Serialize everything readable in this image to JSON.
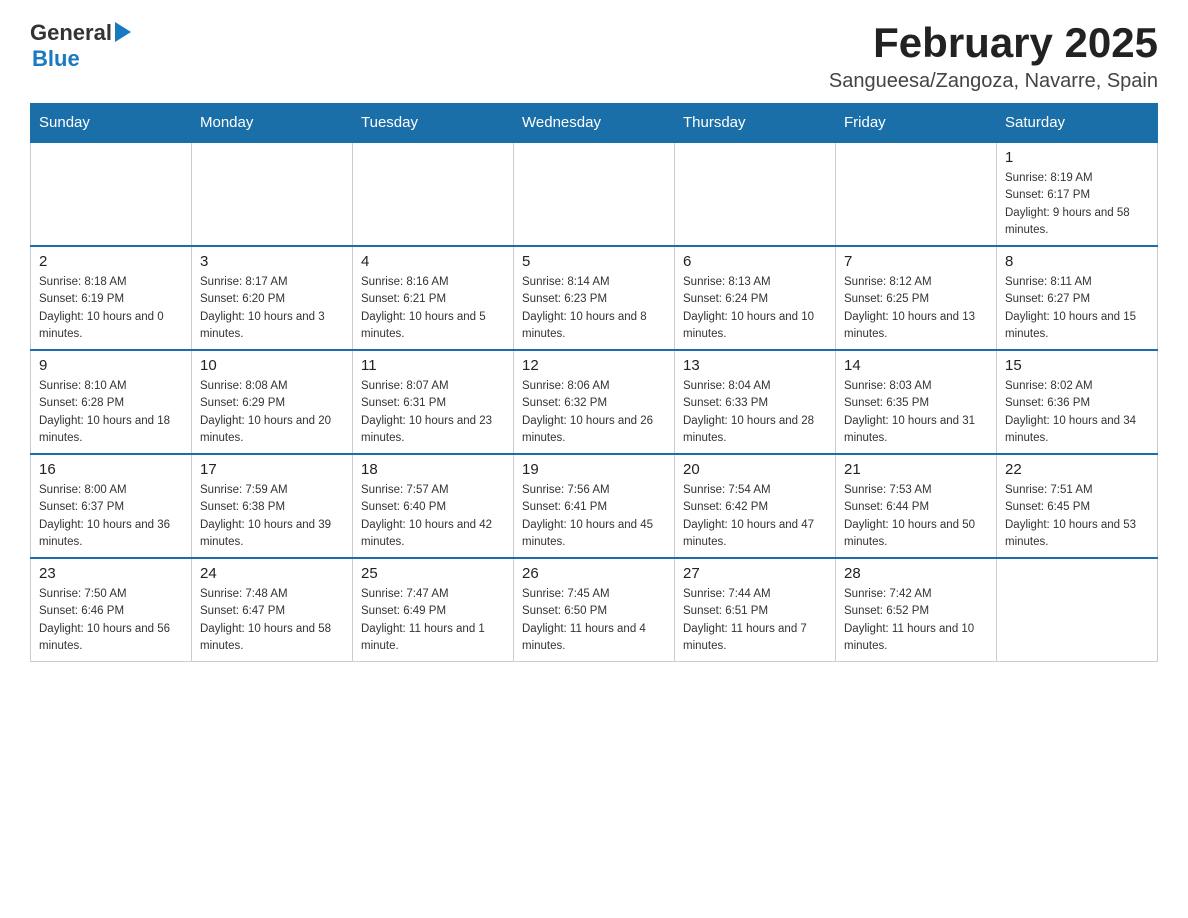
{
  "logo": {
    "general": "General",
    "blue": "Blue"
  },
  "title": "February 2025",
  "location": "Sangueesa/Zangoza, Navarre, Spain",
  "weekdays": [
    "Sunday",
    "Monday",
    "Tuesday",
    "Wednesday",
    "Thursday",
    "Friday",
    "Saturday"
  ],
  "weeks": [
    [
      {
        "day": "",
        "info": ""
      },
      {
        "day": "",
        "info": ""
      },
      {
        "day": "",
        "info": ""
      },
      {
        "day": "",
        "info": ""
      },
      {
        "day": "",
        "info": ""
      },
      {
        "day": "",
        "info": ""
      },
      {
        "day": "1",
        "info": "Sunrise: 8:19 AM\nSunset: 6:17 PM\nDaylight: 9 hours and 58 minutes."
      }
    ],
    [
      {
        "day": "2",
        "info": "Sunrise: 8:18 AM\nSunset: 6:19 PM\nDaylight: 10 hours and 0 minutes."
      },
      {
        "day": "3",
        "info": "Sunrise: 8:17 AM\nSunset: 6:20 PM\nDaylight: 10 hours and 3 minutes."
      },
      {
        "day": "4",
        "info": "Sunrise: 8:16 AM\nSunset: 6:21 PM\nDaylight: 10 hours and 5 minutes."
      },
      {
        "day": "5",
        "info": "Sunrise: 8:14 AM\nSunset: 6:23 PM\nDaylight: 10 hours and 8 minutes."
      },
      {
        "day": "6",
        "info": "Sunrise: 8:13 AM\nSunset: 6:24 PM\nDaylight: 10 hours and 10 minutes."
      },
      {
        "day": "7",
        "info": "Sunrise: 8:12 AM\nSunset: 6:25 PM\nDaylight: 10 hours and 13 minutes."
      },
      {
        "day": "8",
        "info": "Sunrise: 8:11 AM\nSunset: 6:27 PM\nDaylight: 10 hours and 15 minutes."
      }
    ],
    [
      {
        "day": "9",
        "info": "Sunrise: 8:10 AM\nSunset: 6:28 PM\nDaylight: 10 hours and 18 minutes."
      },
      {
        "day": "10",
        "info": "Sunrise: 8:08 AM\nSunset: 6:29 PM\nDaylight: 10 hours and 20 minutes."
      },
      {
        "day": "11",
        "info": "Sunrise: 8:07 AM\nSunset: 6:31 PM\nDaylight: 10 hours and 23 minutes."
      },
      {
        "day": "12",
        "info": "Sunrise: 8:06 AM\nSunset: 6:32 PM\nDaylight: 10 hours and 26 minutes."
      },
      {
        "day": "13",
        "info": "Sunrise: 8:04 AM\nSunset: 6:33 PM\nDaylight: 10 hours and 28 minutes."
      },
      {
        "day": "14",
        "info": "Sunrise: 8:03 AM\nSunset: 6:35 PM\nDaylight: 10 hours and 31 minutes."
      },
      {
        "day": "15",
        "info": "Sunrise: 8:02 AM\nSunset: 6:36 PM\nDaylight: 10 hours and 34 minutes."
      }
    ],
    [
      {
        "day": "16",
        "info": "Sunrise: 8:00 AM\nSunset: 6:37 PM\nDaylight: 10 hours and 36 minutes."
      },
      {
        "day": "17",
        "info": "Sunrise: 7:59 AM\nSunset: 6:38 PM\nDaylight: 10 hours and 39 minutes."
      },
      {
        "day": "18",
        "info": "Sunrise: 7:57 AM\nSunset: 6:40 PM\nDaylight: 10 hours and 42 minutes."
      },
      {
        "day": "19",
        "info": "Sunrise: 7:56 AM\nSunset: 6:41 PM\nDaylight: 10 hours and 45 minutes."
      },
      {
        "day": "20",
        "info": "Sunrise: 7:54 AM\nSunset: 6:42 PM\nDaylight: 10 hours and 47 minutes."
      },
      {
        "day": "21",
        "info": "Sunrise: 7:53 AM\nSunset: 6:44 PM\nDaylight: 10 hours and 50 minutes."
      },
      {
        "day": "22",
        "info": "Sunrise: 7:51 AM\nSunset: 6:45 PM\nDaylight: 10 hours and 53 minutes."
      }
    ],
    [
      {
        "day": "23",
        "info": "Sunrise: 7:50 AM\nSunset: 6:46 PM\nDaylight: 10 hours and 56 minutes."
      },
      {
        "day": "24",
        "info": "Sunrise: 7:48 AM\nSunset: 6:47 PM\nDaylight: 10 hours and 58 minutes."
      },
      {
        "day": "25",
        "info": "Sunrise: 7:47 AM\nSunset: 6:49 PM\nDaylight: 11 hours and 1 minute."
      },
      {
        "day": "26",
        "info": "Sunrise: 7:45 AM\nSunset: 6:50 PM\nDaylight: 11 hours and 4 minutes."
      },
      {
        "day": "27",
        "info": "Sunrise: 7:44 AM\nSunset: 6:51 PM\nDaylight: 11 hours and 7 minutes."
      },
      {
        "day": "28",
        "info": "Sunrise: 7:42 AM\nSunset: 6:52 PM\nDaylight: 11 hours and 10 minutes."
      },
      {
        "day": "",
        "info": ""
      }
    ]
  ]
}
